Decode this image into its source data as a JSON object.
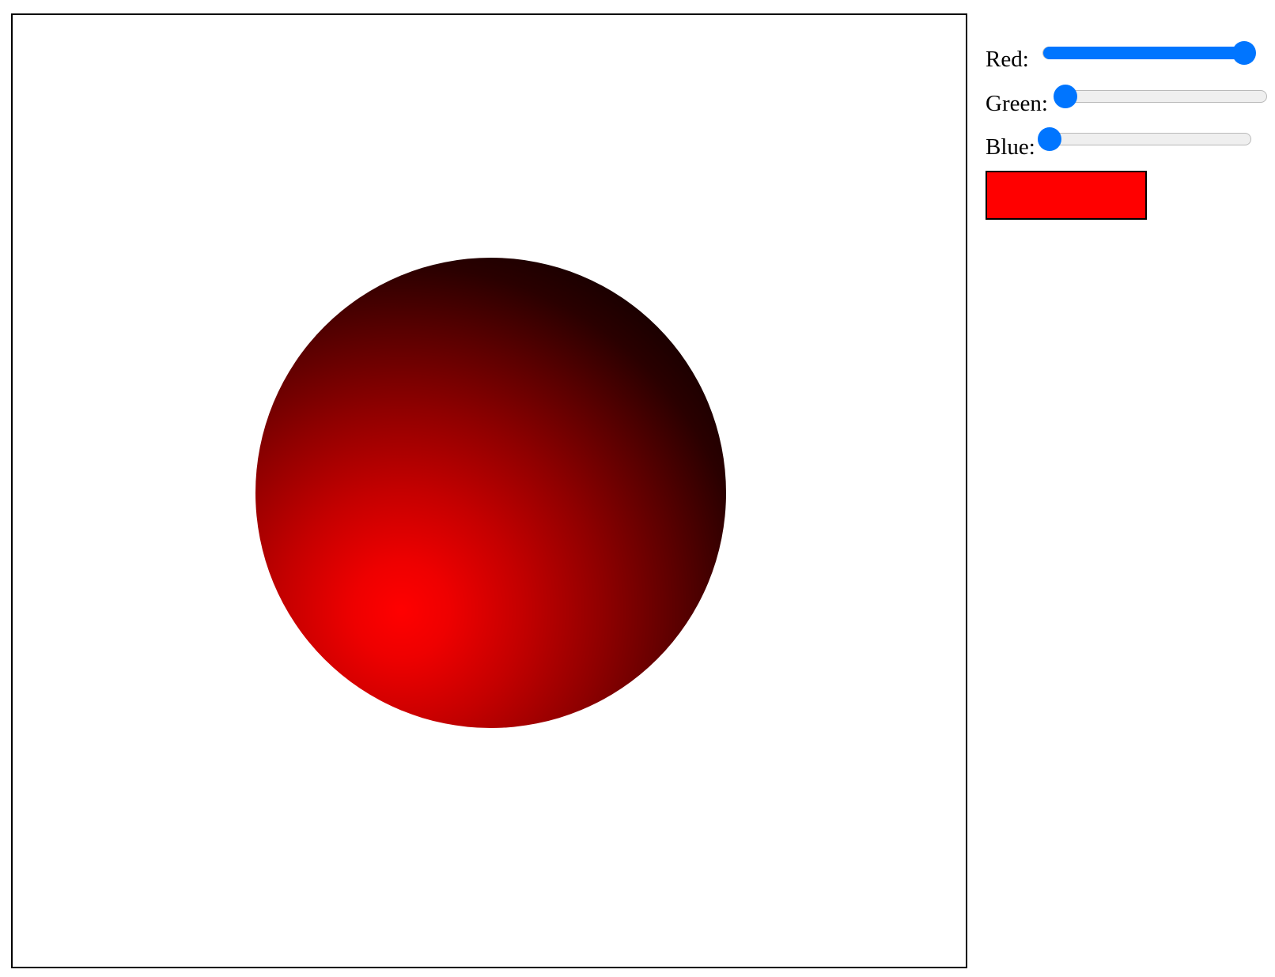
{
  "controls": {
    "red": {
      "label": "Red:",
      "value": 255,
      "min": 0,
      "max": 255,
      "fraction": 1.0
    },
    "green": {
      "label": "Green:",
      "value": 0,
      "min": 0,
      "max": 255,
      "fraction": 0.0
    },
    "blue": {
      "label": "Blue:",
      "value": 0,
      "min": 0,
      "max": 255,
      "fraction": 0.0
    }
  },
  "preview": {
    "color": "#ff0000"
  },
  "sphere": {
    "color": "#ff0000",
    "shadow_color": "#160000"
  },
  "colors": {
    "slider_accent": "#0075ff",
    "slider_track": "#efefef"
  }
}
